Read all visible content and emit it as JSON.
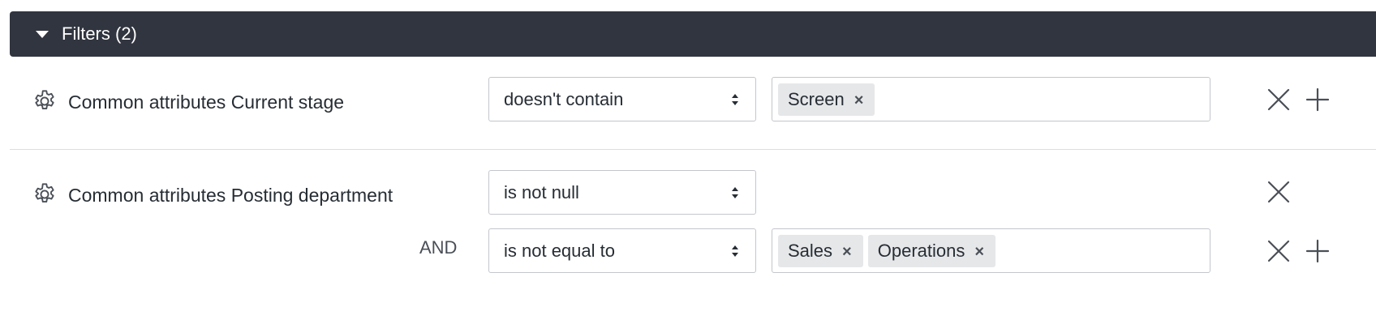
{
  "filters_panel": {
    "title": "Filters (2)"
  },
  "filters": [
    {
      "field_label": "Common attributes Current stage",
      "operator": "doesn't contain",
      "tags": [
        "Screen"
      ]
    },
    {
      "field_label": "Common attributes Posting department",
      "operator": "is not null",
      "sub_condition": {
        "conjunction": "AND",
        "operator": "is not equal to",
        "tags": [
          "Sales",
          "Operations"
        ]
      }
    }
  ],
  "icons": {
    "settings": "gear-icon",
    "remove": "close-icon",
    "add": "plus-icon",
    "remove_tag": "tag-remove-icon",
    "select_arrows": "select-arrows-icon",
    "collapse": "caret-down-icon"
  },
  "colors": {
    "header_bg": "#31353f",
    "header_text": "#ffffff",
    "tag_bg": "#e6e7e9",
    "border": "#c3c6cb"
  },
  "tag_remove_glyph": "×"
}
